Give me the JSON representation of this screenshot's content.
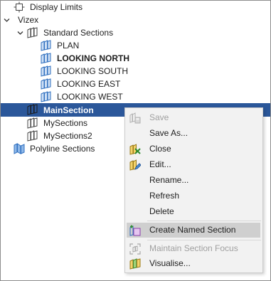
{
  "tree": {
    "display_limits": "Display Limits",
    "vizex": "Vizex",
    "standard_sections": "Standard Sections",
    "plan": "PLAN",
    "looking_north": "LOOKING NORTH",
    "looking_south": "LOOKING SOUTH",
    "looking_east": "LOOKING EAST",
    "looking_west": "LOOKING WEST",
    "main_section": "MainSection",
    "my_sections": "MySections",
    "my_sections2": "MySections2",
    "polyline_sections": "Polyline Sections"
  },
  "context_menu": {
    "save": "Save",
    "save_as": "Save As...",
    "close": "Close",
    "edit": "Edit...",
    "rename": "Rename...",
    "refresh": "Refresh",
    "delete": "Delete",
    "create_named_section": "Create Named Section",
    "maintain_section_focus": "Maintain Section Focus",
    "visualise": "Visualise..."
  },
  "colors": {
    "selection": "#2b579a",
    "section_icon_blue": "#2f6fbf",
    "menu_background": "#f2f2f2",
    "menu_highlight": "#cfcfcf",
    "disabled_text": "#a0a0a0"
  }
}
